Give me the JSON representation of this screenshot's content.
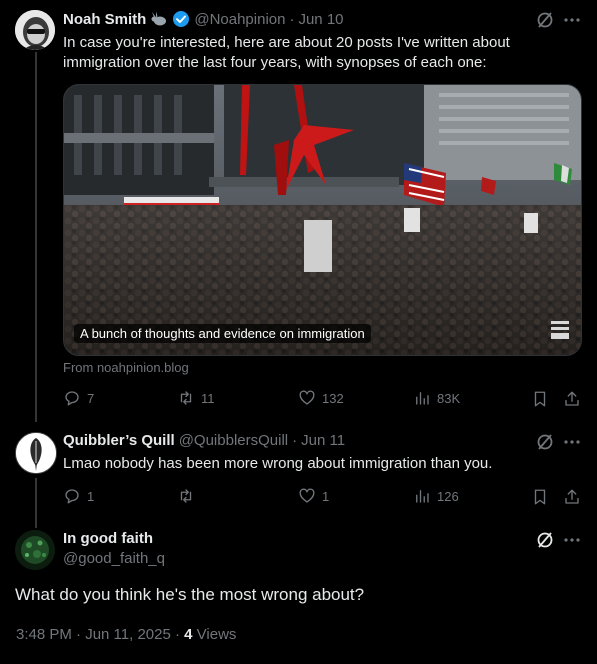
{
  "post1": {
    "name": "Noah Smith",
    "handle": "@Noahpinion",
    "sep": "·",
    "date": "Jun 10",
    "text": "In case you're interested, here are about 20 posts I've written about immigration over the last four years, with synopses of each one:",
    "card_title": "A bunch of thoughts and evidence on immigration",
    "card_source": "From noahpinion.blog",
    "replies": "7",
    "reposts": "11",
    "likes": "132",
    "views": "83K"
  },
  "post2": {
    "name": "Quibbler’s Quill",
    "handle": "@QuibblersQuill",
    "sep": "·",
    "date": "Jun 11",
    "text": "Lmao nobody has been more wrong about immigration than you.",
    "replies": "1",
    "reposts": "",
    "likes": "1",
    "views": "126"
  },
  "post3": {
    "name": "In good faith",
    "handle": "@good_faith_q",
    "text": "What do you think he's the most wrong about?",
    "time": "3:48 PM · Jun 11, 2025 ·",
    "views_count": "4",
    "views_label": "Views"
  },
  "colors": {
    "background": "#000000",
    "text": "#e7e9ea",
    "muted": "#71767b",
    "verified": "#1d9bf0",
    "line": "#333639"
  },
  "icons": [
    "bunny-icon",
    "verified-badge-icon",
    "grok-icon",
    "more-icon",
    "reply-icon",
    "repost-icon",
    "like-icon",
    "views-icon",
    "bookmark-icon",
    "share-icon"
  ]
}
